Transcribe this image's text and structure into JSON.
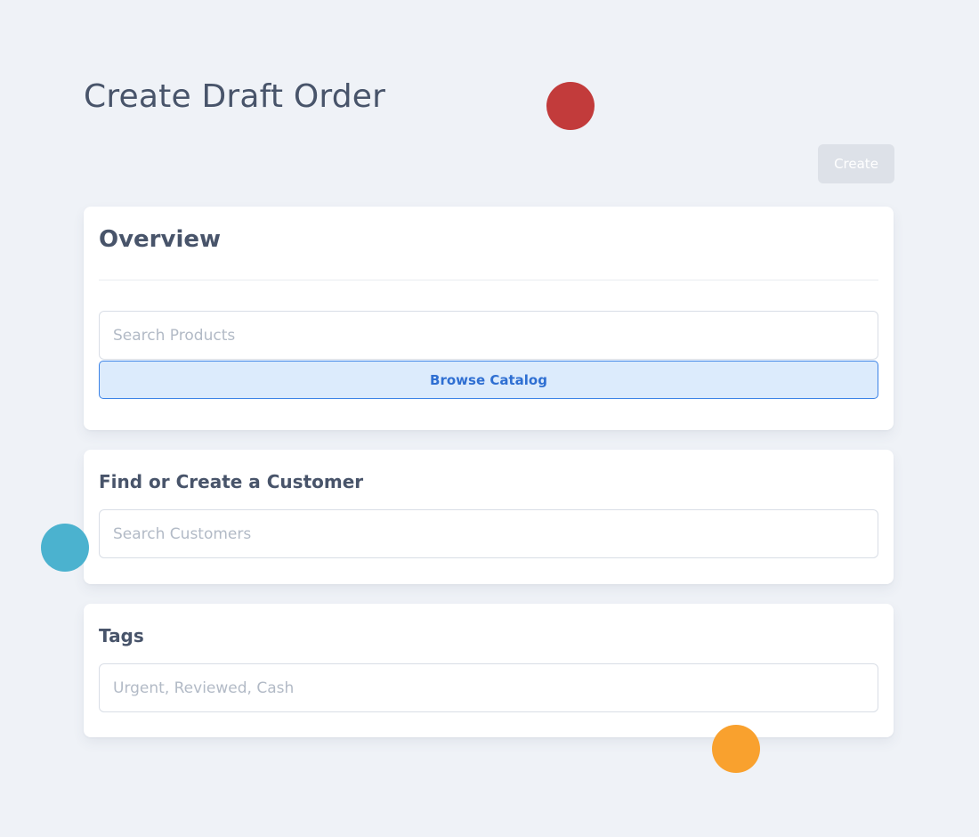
{
  "page": {
    "title": "Create Draft Order"
  },
  "toolbar": {
    "create_label": "Create"
  },
  "overview": {
    "heading": "Overview",
    "product_search_placeholder": "Search Products",
    "product_search_value": "",
    "browse_catalog_label": "Browse Catalog"
  },
  "customer": {
    "heading": "Find or Create a Customer",
    "search_placeholder": "Search Customers",
    "search_value": ""
  },
  "tags": {
    "heading": "Tags",
    "placeholder": "Urgent, Reviewed, Cash",
    "value": ""
  },
  "colors": {
    "background": "#eff2f7",
    "text": "#48546a",
    "accent": "#3b82e6",
    "create_button_disabled": "#dde1e8",
    "dot_red": "#c23b3b",
    "dot_blue": "#4bb2cf",
    "dot_orange": "#f9a12e"
  },
  "decorations": [
    {
      "name": "red-dot",
      "color": "#c23b3b"
    },
    {
      "name": "blue-dot",
      "color": "#4bb2cf"
    },
    {
      "name": "orange-dot",
      "color": "#f9a12e"
    }
  ]
}
